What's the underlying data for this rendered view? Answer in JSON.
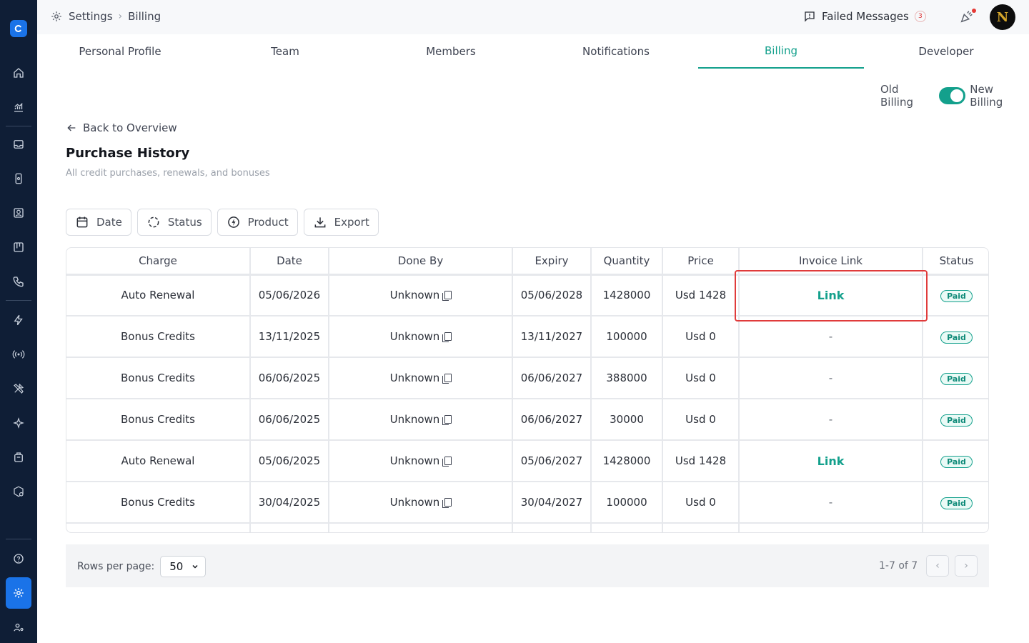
{
  "breadcrumb": {
    "root": "Settings",
    "current": "Billing"
  },
  "header": {
    "failed_label": "Failed Messages",
    "failed_count": "3",
    "avatar_initial": "N"
  },
  "tabs": [
    "Personal Profile",
    "Team",
    "Members",
    "Notifications",
    "Billing",
    "Developer"
  ],
  "active_tab": "Billing",
  "toggle": {
    "left": "Old Billing",
    "right": "New Billing",
    "state": "on"
  },
  "back_label": "Back to Overview",
  "page": {
    "title": "Purchase History",
    "subtitle": "All credit purchases, renewals, and bonuses"
  },
  "filters": {
    "date": "Date",
    "status": "Status",
    "product": "Product",
    "export": "Export"
  },
  "table": {
    "columns": [
      "Charge",
      "Date",
      "Done By",
      "Expiry",
      "Quantity",
      "Price",
      "Invoice Link",
      "Status"
    ],
    "rows": [
      {
        "charge": "Auto Renewal",
        "date": "05/06/2026",
        "done_by": "Unknown",
        "expiry": "05/06/2028",
        "quantity": "1428000",
        "price": "Usd 1428",
        "invoice": "Link",
        "status": "Paid"
      },
      {
        "charge": "Bonus Credits",
        "date": "13/11/2025",
        "done_by": "Unknown",
        "expiry": "13/11/2027",
        "quantity": "100000",
        "price": "Usd 0",
        "invoice": "-",
        "status": "Paid"
      },
      {
        "charge": "Bonus Credits",
        "date": "06/06/2025",
        "done_by": "Unknown",
        "expiry": "06/06/2027",
        "quantity": "388000",
        "price": "Usd 0",
        "invoice": "-",
        "status": "Paid"
      },
      {
        "charge": "Bonus Credits",
        "date": "06/06/2025",
        "done_by": "Unknown",
        "expiry": "06/06/2027",
        "quantity": "30000",
        "price": "Usd 0",
        "invoice": "-",
        "status": "Paid"
      },
      {
        "charge": "Auto Renewal",
        "date": "05/06/2025",
        "done_by": "Unknown",
        "expiry": "05/06/2027",
        "quantity": "1428000",
        "price": "Usd 1428",
        "invoice": "Link",
        "status": "Paid"
      },
      {
        "charge": "Bonus Credits",
        "date": "30/04/2025",
        "done_by": "Unknown",
        "expiry": "30/04/2027",
        "quantity": "100000",
        "price": "Usd 0",
        "invoice": "-",
        "status": "Paid"
      }
    ]
  },
  "pagination": {
    "rows_label": "Rows per page:",
    "rows_value": "50",
    "range": "1-7 of 7"
  },
  "colors": {
    "accent": "#13a08c",
    "sidebar": "#0f1e36",
    "active_nav": "#1a73e8",
    "highlight": "#e03b3b"
  }
}
